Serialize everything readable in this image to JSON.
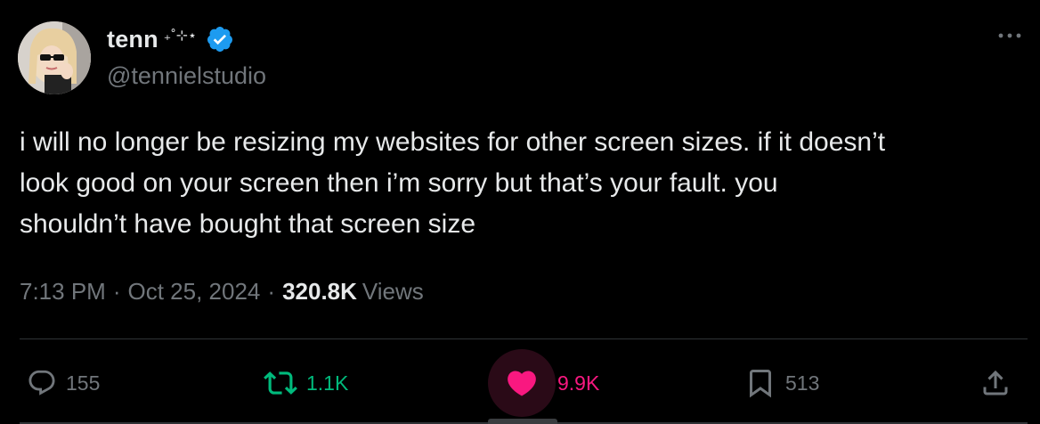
{
  "author": {
    "display_name": "tenn",
    "name_decoration": "₊˚⊹⋆",
    "handle": "@tennielstudio",
    "verified": true
  },
  "tweet": {
    "text": "i will no longer be resizing my websites for other screen sizes. if it doesn’t\nlook good on your screen then i’m sorry but that’s your fault. you\nshouldn’t have bought that screen size",
    "time": "7:13 PM",
    "separator": "·",
    "date": "Oct 25, 2024",
    "views_count": "320.8K",
    "views_label": "Views"
  },
  "actions": {
    "replies": "155",
    "reposts": "1.1K",
    "likes": "9.9K",
    "bookmarks": "513",
    "liked": true
  },
  "icons": {
    "more": "more-icon",
    "reply": "reply-icon",
    "repost": "repost-icon",
    "like": "heart-icon",
    "bookmark": "bookmark-icon",
    "share": "share-icon",
    "verified": "verified-badge-icon"
  },
  "colors": {
    "background": "#000000",
    "text": "#e7e9ea",
    "muted": "#71767b",
    "verified": "#1d9bf0",
    "repost": "#00ba7c",
    "like": "#f91880",
    "divider": "#2f3336"
  }
}
